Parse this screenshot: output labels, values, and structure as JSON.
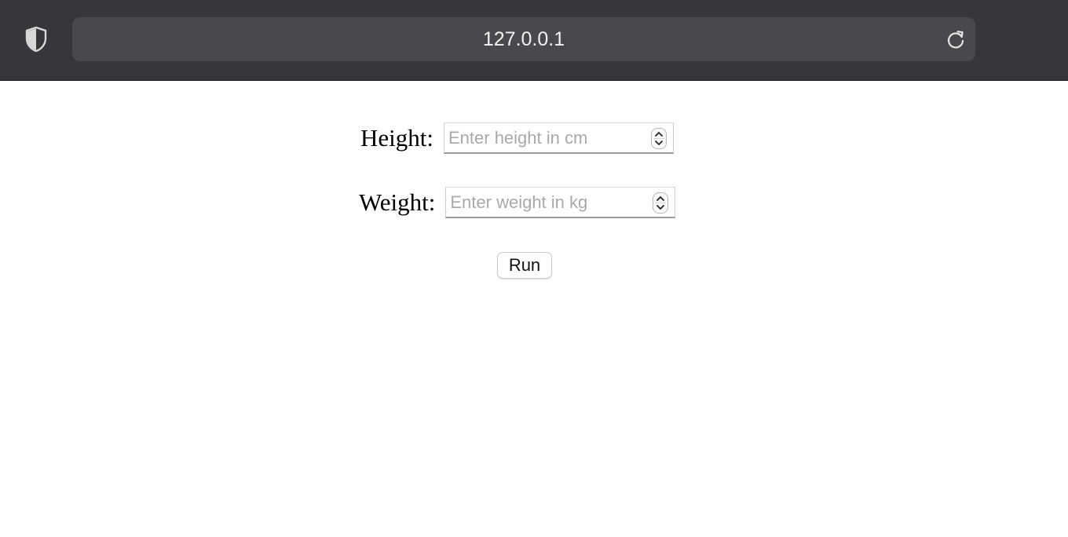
{
  "browser": {
    "url": "127.0.0.1",
    "icons": {
      "security": "shield-icon",
      "reload": "reload-icon"
    },
    "colors": {
      "toolbar_bg": "#38363a",
      "urlbar_bg": "#4a484c",
      "url_text": "#f2f2f2"
    }
  },
  "form": {
    "height": {
      "label": "Height:",
      "placeholder": "Enter height in cm",
      "value": ""
    },
    "weight": {
      "label": "Weight:",
      "placeholder": "Enter weight in kg",
      "value": ""
    },
    "submit_label": "Run",
    "stepper_icons": {
      "up": "chevron-up-icon",
      "down": "chevron-down-icon"
    }
  }
}
